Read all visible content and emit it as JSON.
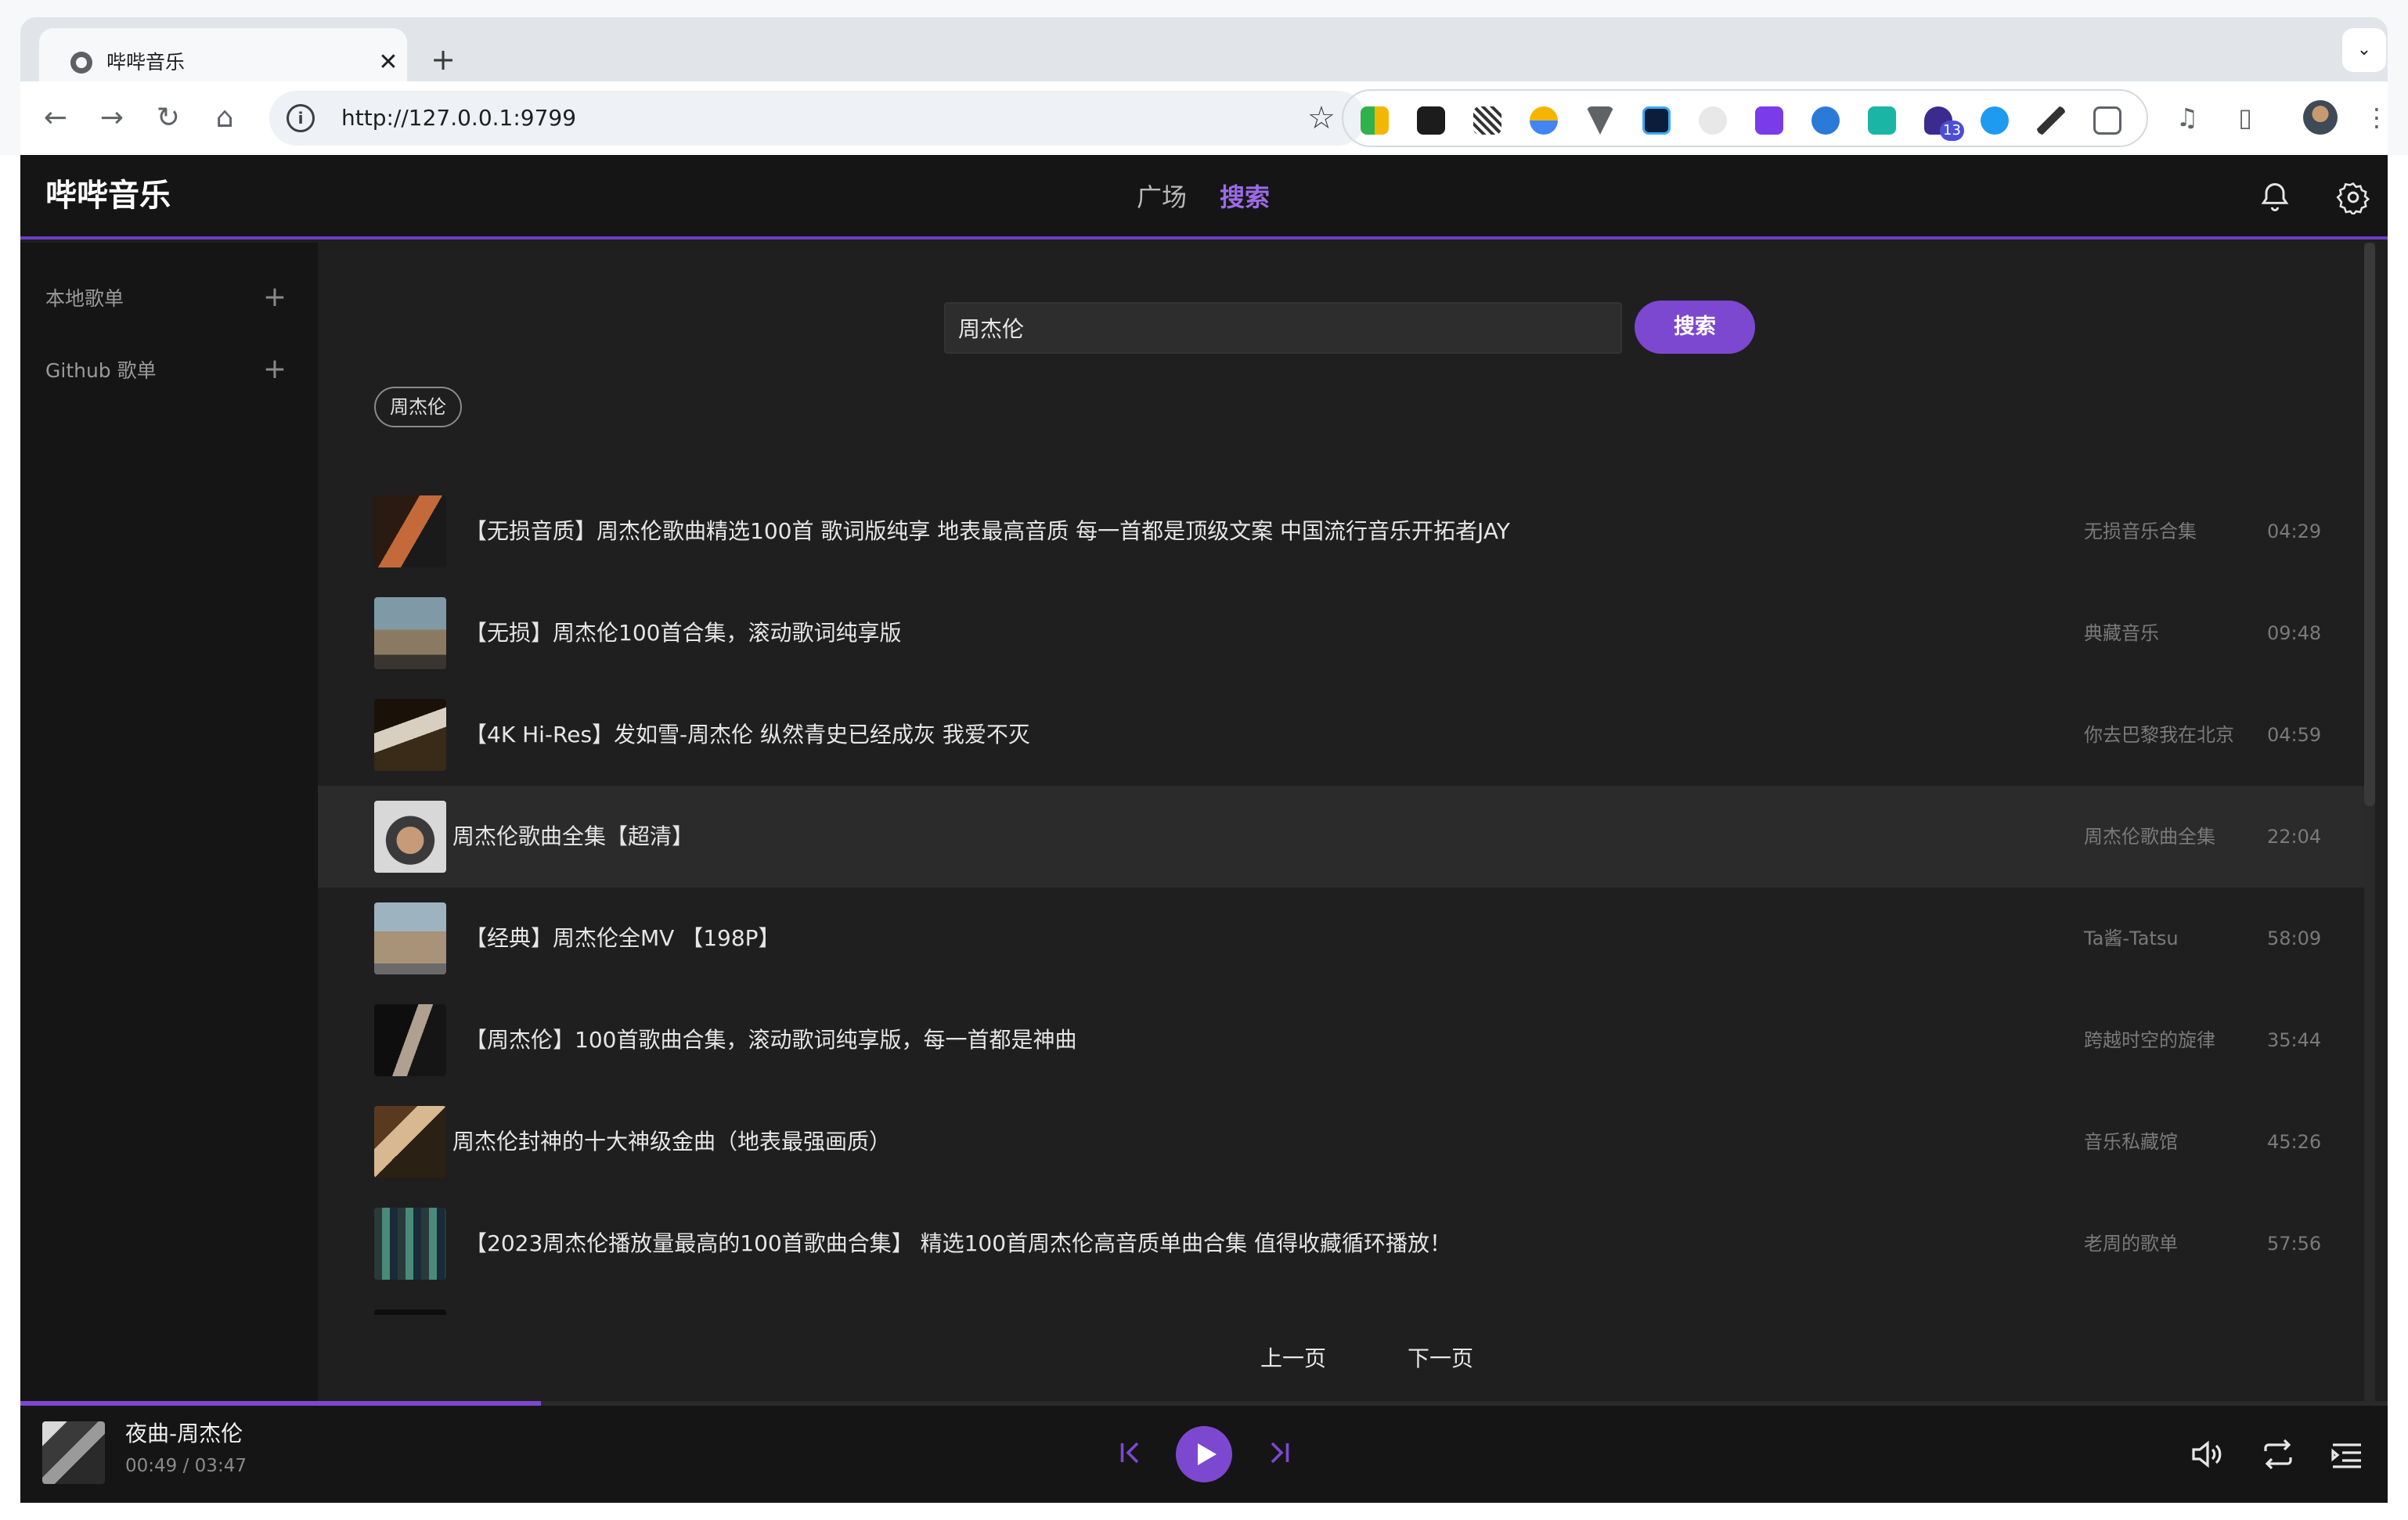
{
  "browser": {
    "tab_title": "哔哔音乐",
    "tab_close": "✕",
    "new_tab": "+",
    "url": "http://127.0.0.1:9799",
    "extension_badge": "13"
  },
  "app": {
    "logo": "哔哔音乐",
    "nav": {
      "plaza": "广场",
      "search": "搜索"
    },
    "accent": "#7c48d0"
  },
  "sidebar": {
    "items": [
      {
        "label": "本地歌单",
        "action": "+"
      },
      {
        "label": "Github 歌单",
        "action": "+"
      }
    ]
  },
  "search": {
    "query": "周杰伦",
    "button": "搜索",
    "history_tag": "周杰伦"
  },
  "results": [
    {
      "title": "【无损音质】周杰伦歌曲精选100首 歌词版纯享 地表最高音质 每一首都是顶级文案 中国流行音乐开拓者JAY",
      "author": "无损音乐合集",
      "duration": "04:29"
    },
    {
      "title": "【无损】周杰伦100首合集，滚动歌词纯享版",
      "author": "典藏音乐",
      "duration": "09:48"
    },
    {
      "title": "【4K Hi-Res】发如雪-周杰伦 纵然青史已经成灰 我爱不灭",
      "author": "你去巴黎我在北京",
      "duration": "04:59"
    },
    {
      "title": "周杰伦歌曲全集【超清】",
      "author": "周杰伦歌曲全集",
      "duration": "22:04"
    },
    {
      "title": "【经典】周杰伦全MV 【198P】",
      "author": "Ta酱-Tatsu",
      "duration": "58:09"
    },
    {
      "title": "【周杰伦】100首歌曲合集，滚动歌词纯享版，每一首都是神曲",
      "author": "跨越时空的旋律",
      "duration": "35:44"
    },
    {
      "title": "周杰伦封神的十大神级金曲（地表最强画质）",
      "author": "音乐私藏馆",
      "duration": "45:26"
    },
    {
      "title": "【2023周杰伦播放量最高的100首歌曲合集】 精选100首周杰伦高音质单曲合集 值得收藏循环播放！",
      "author": "老周的歌单",
      "duration": "57:56"
    }
  ],
  "pager": {
    "prev": "上一页",
    "next": "下一页"
  },
  "player": {
    "title": "夜曲-周杰伦",
    "current": "00:49",
    "separator": "/",
    "total": "03:47",
    "progress": 0.22
  }
}
